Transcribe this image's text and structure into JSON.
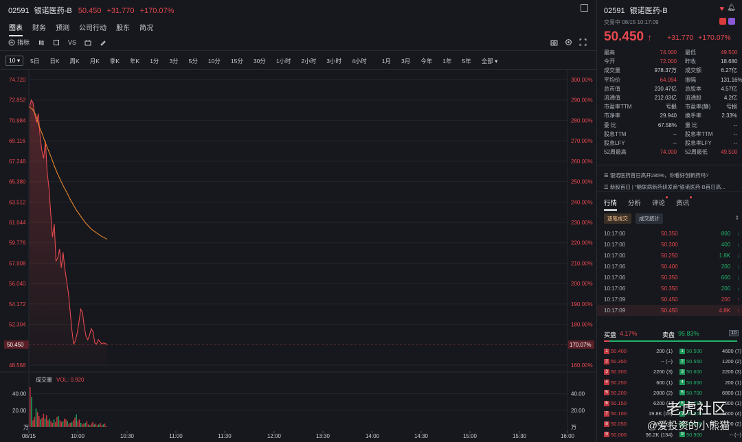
{
  "header": {
    "code": "02591",
    "name": "银诺医药-B",
    "price": "50.450",
    "change": "+31.770",
    "change_pct": "+170.07%"
  },
  "nav_tabs": [
    "图表",
    "财务",
    "预测",
    "公司行动",
    "股东",
    "简况"
  ],
  "toolbar": {
    "indicator": "指标",
    "vs": "VS"
  },
  "period_select": "10",
  "periods": [
    "5日",
    "日K",
    "周K",
    "月K",
    "季K",
    "年K",
    "1分",
    "3分",
    "5分",
    "10分",
    "15分",
    "30分",
    "1小时",
    "2小时",
    "3小时",
    "4小时",
    "1月",
    "3月",
    "今年",
    "1年",
    "5年",
    "全部"
  ],
  "chart_data": {
    "type": "line",
    "price_axis": [
      "74.720",
      "72.852",
      "70.984",
      "69.116",
      "67.248",
      "65.380",
      "63.512",
      "61.644",
      "59.776",
      "57.908",
      "56.040",
      "54.172",
      "52.304",
      "50.450",
      "48.568"
    ],
    "pct_axis": [
      "300.00%",
      "290.00%",
      "280.00%",
      "270.00%",
      "260.00%",
      "250.00%",
      "240.00%",
      "230.00%",
      "220.00%",
      "210.00%",
      "200.00%",
      "190.00%",
      "180.00%",
      "170.07%",
      "160.00%"
    ],
    "ylim": [
      48.568,
      74.72
    ],
    "current_price": 50.45,
    "current_pct": "170.07%",
    "x_labels": [
      "08/15",
      "10:00",
      "10:30",
      "11:00",
      "11:30",
      "12:00",
      "13:30",
      "14:00",
      "14:30",
      "15:00",
      "15:30",
      "16:00"
    ],
    "price_series": [
      72.2,
      72.85,
      72.6,
      71.5,
      70.8,
      71.6,
      69.5,
      68.2,
      67.5,
      69.1,
      66.2,
      64.8,
      62.5,
      60.3,
      61.5,
      58.1,
      58.4,
      59.2,
      57.5,
      58.9,
      57.4,
      56.3,
      55.2,
      53.5,
      51.8,
      50.5,
      50.8,
      51.5,
      52.5,
      53.7,
      53.4,
      52.1,
      51.2,
      50.9,
      51.3,
      51.9,
      51.6,
      50.6,
      50.5,
      50.9,
      50.7,
      50.5,
      50.6,
      50.55,
      50.45
    ],
    "avg_series": [
      72.2,
      72.0,
      71.5,
      70.5,
      69.8,
      69.0,
      68.3,
      67.6,
      66.8,
      66.1,
      65.5,
      64.9,
      64.4,
      63.8,
      63.3,
      62.8,
      62.4,
      62.0,
      61.6,
      61.3,
      61.0,
      60.8,
      60.6,
      60.4,
      60.25,
      60.1
    ],
    "volume_label": "成交量",
    "volume_value": "VOL: 0.920",
    "volume_axis": [
      "40.00",
      "20.00",
      "万"
    ],
    "volume_ylim": [
      0,
      48
    ],
    "volume_series": [
      48,
      36,
      8,
      12,
      22,
      18,
      13,
      9,
      11,
      16,
      10,
      14,
      8,
      10,
      7,
      5,
      9,
      6,
      12,
      13,
      8,
      6,
      7,
      10,
      9,
      7,
      4,
      5,
      6,
      8,
      11,
      15,
      7,
      9,
      5,
      3,
      4,
      5,
      7,
      3,
      2,
      4,
      6,
      3,
      4,
      2,
      3,
      5,
      2,
      3,
      4,
      1
    ]
  },
  "right": {
    "status": "交易中 08/15 10:17:09",
    "price": "50.450",
    "arrow": "↑",
    "change": "+31.770",
    "change_pct": "+170.07%",
    "stats": [
      [
        "最高",
        "74.000",
        "最低",
        "49.500"
      ],
      [
        "今开",
        "72.000",
        "昨收",
        "18.680"
      ],
      [
        "成交量",
        "978.37万",
        "成交额",
        "6.27亿"
      ],
      [
        "平均价",
        "64.094",
        "振幅",
        "131.16%"
      ],
      [
        "总市值",
        "230.47亿",
        "总股本",
        "4.57亿"
      ],
      [
        "流通值",
        "212.03亿",
        "流通股",
        "4.2亿"
      ],
      [
        "市盈率TTM",
        "亏损",
        "市盈率(静)",
        "亏损"
      ],
      [
        "市净率",
        "29.940",
        "换手率",
        "2.33%"
      ],
      [
        "委 比",
        "67.58%",
        "量 比",
        "--"
      ],
      [
        "股息TTM",
        "--",
        "股息率TTM",
        "--"
      ],
      [
        "股息LFY",
        "--",
        "股息率LFY",
        "--"
      ],
      [
        "52周最高",
        "74.000",
        "52周最低",
        "49.500"
      ]
    ],
    "news": [
      "银诺医药首日高开285%，你看好创新药吗?",
      "新股首日 | \"糖尿病新药研发商\"银诺医药-B首日高..."
    ],
    "tabs": [
      "行情",
      "分析",
      "评论",
      "资讯"
    ],
    "subtabs": [
      "逐笔成交",
      "成交统计"
    ],
    "trades": [
      [
        "10:17:00",
        "50.350",
        "800",
        "down"
      ],
      [
        "10:17:00",
        "50.300",
        "400",
        "down"
      ],
      [
        "10:17:00",
        "50.250",
        "1.8K",
        "down"
      ],
      [
        "10:17:06",
        "50.400",
        "200",
        "down"
      ],
      [
        "10:17:06",
        "50.350",
        "600",
        "down"
      ],
      [
        "10:17:06",
        "50.350",
        "200",
        "down"
      ],
      [
        "10:17:09",
        "50.450",
        "200",
        "up"
      ],
      [
        "10:17:09",
        "50.450",
        "4.8K",
        "up"
      ]
    ],
    "bid_label": "买盘",
    "bid_pct": "4.17%",
    "ask_label": "卖盘",
    "ask_pct": "95.83%",
    "depth_btn": "10",
    "orderbook": [
      [
        "1",
        "50.400",
        "200 (",
        "1)",
        "1",
        "50.500",
        "4600 (",
        "7)"
      ],
      [
        "2",
        "50.350",
        "-- (",
        "--)",
        "2",
        "50.550",
        "1200 (",
        "2)"
      ],
      [
        "3",
        "50.300",
        "2200 (",
        "3)",
        "3",
        "50.600",
        "2200 (",
        "3)"
      ],
      [
        "4",
        "50.250",
        "600 (",
        "1)",
        "4",
        "50.650",
        "200 (",
        "1)"
      ],
      [
        "5",
        "50.200",
        "2000 (",
        "2)",
        "5",
        "50.700",
        "6800 (",
        "1)"
      ],
      [
        "6",
        "50.150",
        "6200 (",
        "1)",
        "6",
        "50.750",
        "1800 (",
        "1)"
      ],
      [
        "7",
        "50.100",
        "19.8K (",
        "28)",
        "7",
        "50.800",
        "6600 (",
        "4)"
      ],
      [
        "8",
        "50.050",
        "4600 (",
        "4)",
        "8",
        "50.850",
        "2000 (",
        "2)"
      ],
      [
        "9",
        "50.000",
        "96.2K (",
        "134)",
        "9",
        "50.900",
        "-- (",
        "--)"
      ]
    ],
    "watermark": "老虎社区",
    "watermark2": "@爱投资的小熊猫"
  },
  "colors": {
    "up": "#e8494f",
    "down": "#21b46a",
    "avg": "#e8862f",
    "bg": "#16181d"
  }
}
